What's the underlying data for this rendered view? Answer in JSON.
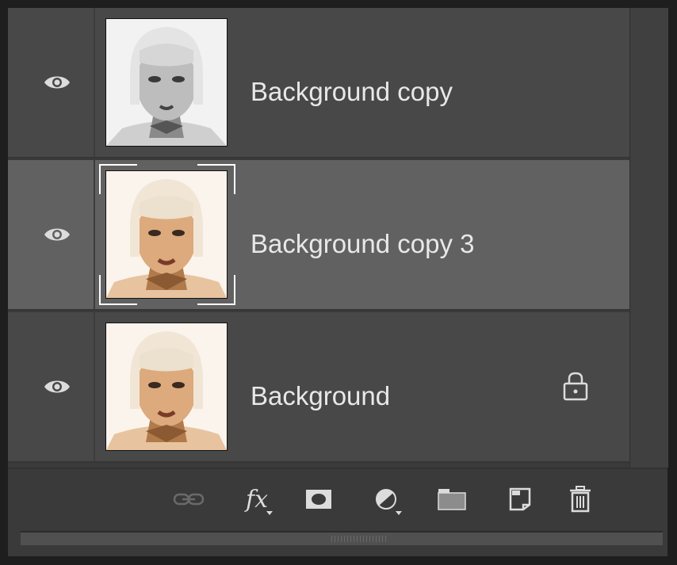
{
  "layers": [
    {
      "name": "Background copy",
      "visible": true,
      "selected": false,
      "locked": false,
      "thumbnail": "grayscale-portrait"
    },
    {
      "name": "Background copy 3",
      "visible": true,
      "selected": true,
      "locked": false,
      "thumbnail": "color-portrait"
    },
    {
      "name": "Background",
      "visible": true,
      "selected": false,
      "locked": true,
      "thumbnail": "color-portrait"
    }
  ],
  "footer_buttons": [
    {
      "icon": "link-layers-icon",
      "enabled": false
    },
    {
      "icon": "fx-icon",
      "label": "fx"
    },
    {
      "icon": "layer-mask-icon"
    },
    {
      "icon": "adjustment-layer-icon"
    },
    {
      "icon": "new-group-icon"
    },
    {
      "icon": "new-layer-icon"
    },
    {
      "icon": "trash-icon"
    }
  ],
  "colors": {
    "panel_bg": "#3a3a3a",
    "row_bg": "#484848",
    "row_selected_bg": "#616161",
    "text": "#e8e8e8",
    "icon": "#dcdcdc"
  }
}
